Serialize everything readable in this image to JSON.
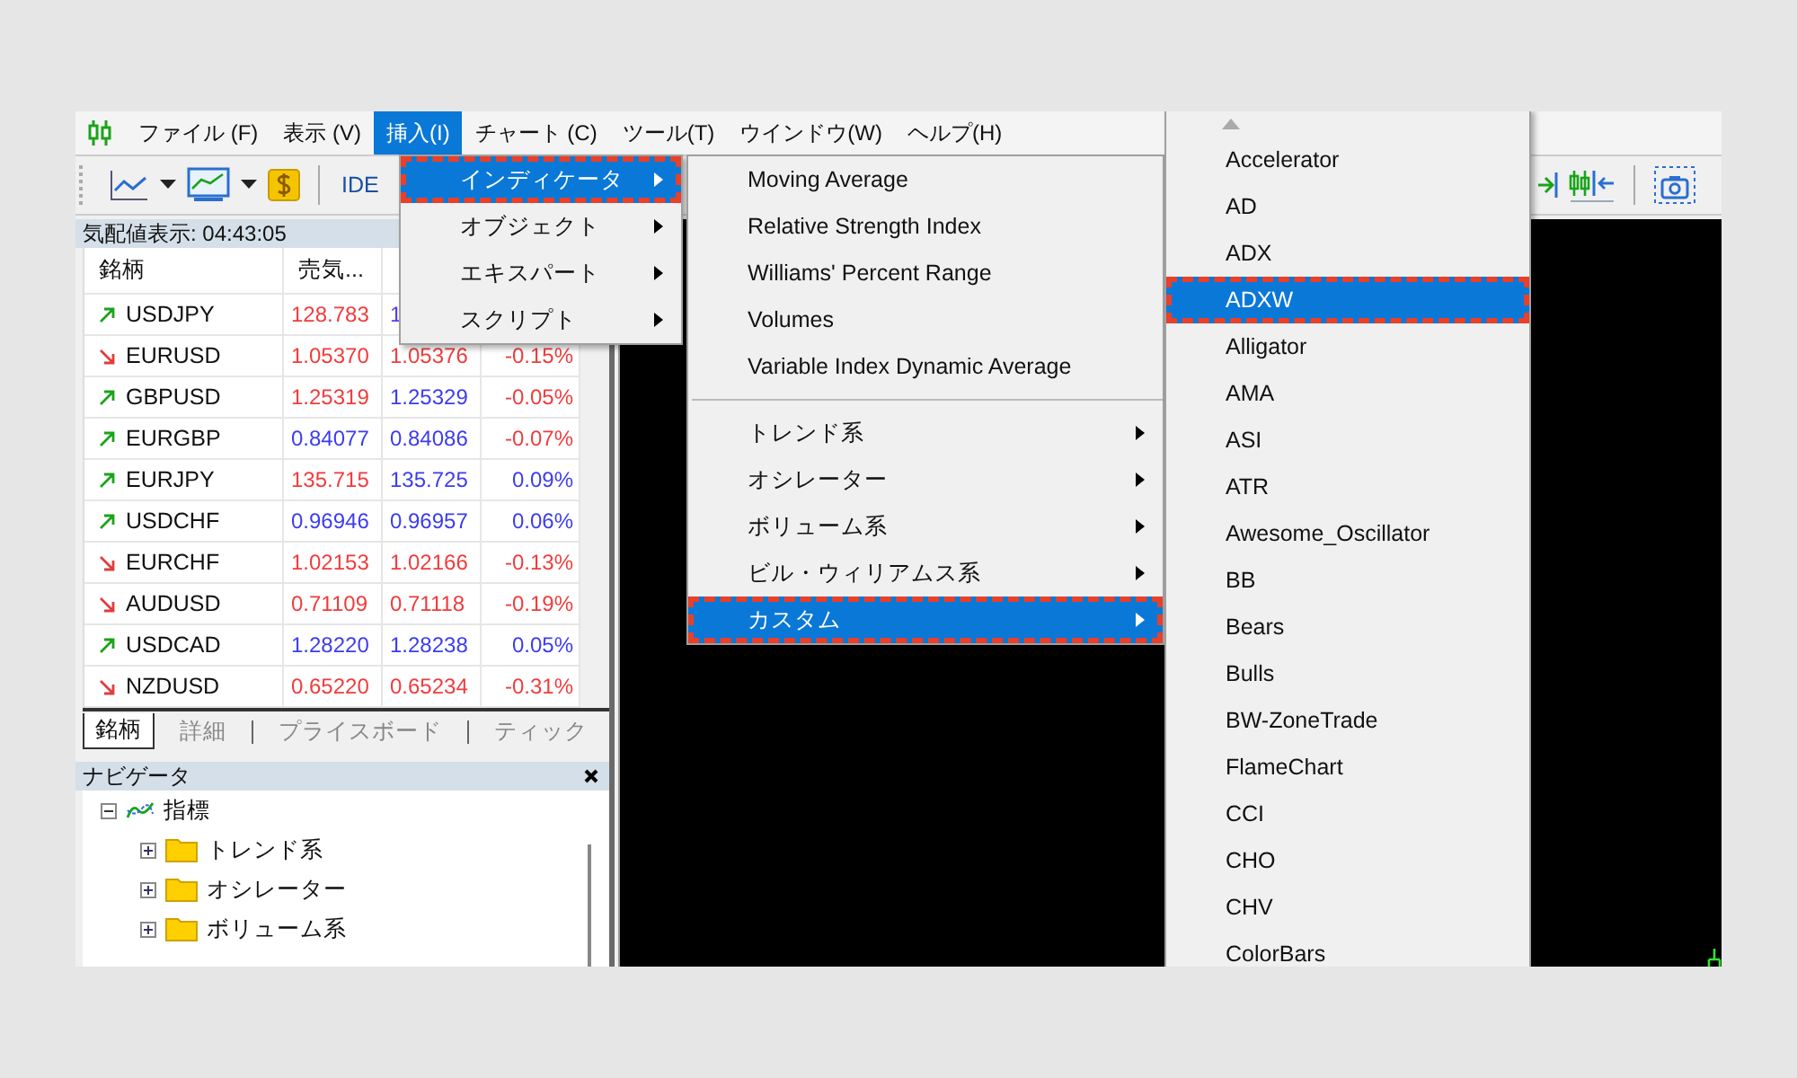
{
  "menu_bar": {
    "items": [
      {
        "label": "ファイル (F)",
        "selected": false
      },
      {
        "label": "表示 (V)",
        "selected": false
      },
      {
        "label": "挿入(I)",
        "selected": true
      },
      {
        "label": "チャート (C)",
        "selected": false
      },
      {
        "label": "ツール(T)",
        "selected": false
      },
      {
        "label": "ウインドウ(W)",
        "selected": false
      },
      {
        "label": "ヘルプ(H)",
        "selected": false
      }
    ]
  },
  "toolbar": {
    "ide_label": "IDE"
  },
  "market_watch": {
    "title": "気配値表示: 04:43:05",
    "columns": [
      "銘柄",
      "売気..."
    ],
    "rows": [
      {
        "symbol": "USDJPY",
        "rising": true,
        "bid": {
          "text": "128.783",
          "color": "#f03c3c"
        },
        "ask": {
          "text": "1",
          "color": "#5a3cf0"
        }
      },
      {
        "symbol": "EURUSD",
        "rising": false,
        "bid": {
          "text": "1.05370",
          "color": "#f03c3c"
        },
        "ask": {
          "text": "1.05376",
          "color": "#f03c3c"
        },
        "change": {
          "text": "-0.15%",
          "color": "#f03c3c"
        }
      },
      {
        "symbol": "GBPUSD",
        "rising": true,
        "bid": {
          "text": "1.25319",
          "color": "#f03c3c"
        },
        "ask": {
          "text": "1.25329",
          "color": "#3c3cf0"
        },
        "change": {
          "text": "-0.05%",
          "color": "#f03c3c"
        }
      },
      {
        "symbol": "EURGBP",
        "rising": true,
        "bid": {
          "text": "0.84077",
          "color": "#3c3cf0"
        },
        "ask": {
          "text": "0.84086",
          "color": "#3c3cf0"
        },
        "change": {
          "text": "-0.07%",
          "color": "#f03c3c"
        }
      },
      {
        "symbol": "EURJPY",
        "rising": true,
        "bid": {
          "text": "135.715",
          "color": "#f03c3c"
        },
        "ask": {
          "text": "135.725",
          "color": "#3c3cf0"
        },
        "change": {
          "text": "0.09%",
          "color": "#3c3cf0"
        }
      },
      {
        "symbol": "USDCHF",
        "rising": true,
        "bid": {
          "text": "0.96946",
          "color": "#3c3cf0"
        },
        "ask": {
          "text": "0.96957",
          "color": "#3c3cf0"
        },
        "change": {
          "text": "0.06%",
          "color": "#3c3cf0"
        }
      },
      {
        "symbol": "EURCHF",
        "rising": false,
        "bid": {
          "text": "1.02153",
          "color": "#f03c3c"
        },
        "ask": {
          "text": "1.02166",
          "color": "#f03c3c"
        },
        "change": {
          "text": "-0.13%",
          "color": "#f03c3c"
        }
      },
      {
        "symbol": "AUDUSD",
        "rising": false,
        "bid": {
          "text": "0.71109",
          "color": "#f03c3c"
        },
        "ask": {
          "text": "0.71118",
          "color": "#f03c3c"
        },
        "change": {
          "text": "-0.19%",
          "color": "#f03c3c"
        }
      },
      {
        "symbol": "USDCAD",
        "rising": true,
        "bid": {
          "text": "1.28220",
          "color": "#3c3cf0"
        },
        "ask": {
          "text": "1.28238",
          "color": "#3c3cf0"
        },
        "change": {
          "text": "0.05%",
          "color": "#3c3cf0"
        }
      },
      {
        "symbol": "NZDUSD",
        "rising": false,
        "bid": {
          "text": "0.65220",
          "color": "#f03c3c"
        },
        "ask": {
          "text": "0.65234",
          "color": "#f03c3c"
        },
        "change": {
          "text": "-0.31%",
          "color": "#f03c3c"
        }
      }
    ],
    "tabs": [
      {
        "label": "銘柄",
        "selected": true
      },
      {
        "label": "詳細",
        "selected": false
      },
      {
        "label": "プライスボード",
        "selected": false
      },
      {
        "label": "ティック",
        "selected": false
      }
    ]
  },
  "navigator": {
    "title": "ナビゲータ",
    "tree": [
      {
        "label": "指標",
        "expanded": true,
        "children": [
          {
            "label": "トレンド系",
            "expanded": false
          },
          {
            "label": "オシレーター",
            "expanded": false
          },
          {
            "label": "ボリューム系",
            "expanded": false
          }
        ]
      }
    ]
  },
  "insert_menu": {
    "items": [
      {
        "label": "インディケータ",
        "selected": true,
        "highlighted": true
      },
      {
        "label": "オブジェクト",
        "selected": false,
        "highlighted": false
      },
      {
        "label": "エキスパート",
        "selected": false,
        "highlighted": false
      },
      {
        "label": "スクリプト",
        "selected": false,
        "highlighted": false
      }
    ]
  },
  "indicator_menu": {
    "items": [
      {
        "kind": "item",
        "label": "Moving Average",
        "selected": false,
        "highlighted": false
      },
      {
        "kind": "item",
        "label": "Relative Strength Index",
        "selected": false,
        "highlighted": false
      },
      {
        "kind": "item",
        "label": "Williams' Percent Range",
        "selected": false,
        "highlighted": false
      },
      {
        "kind": "item",
        "label": "Volumes",
        "selected": false,
        "highlighted": false
      },
      {
        "kind": "item",
        "label": "Variable Index Dynamic Average",
        "selected": false,
        "highlighted": false
      },
      {
        "kind": "separator"
      },
      {
        "kind": "submenu",
        "label": "トレンド系",
        "selected": false,
        "highlighted": false
      },
      {
        "kind": "submenu",
        "label": "オシレーター",
        "selected": false,
        "highlighted": false
      },
      {
        "kind": "submenu",
        "label": "ボリューム系",
        "selected": false,
        "highlighted": false
      },
      {
        "kind": "submenu",
        "label": "ビル・ウィリアムス系",
        "selected": false,
        "highlighted": false
      },
      {
        "kind": "submenu",
        "label": "カスタム",
        "selected": true,
        "highlighted": true
      }
    ]
  },
  "custom_menu": {
    "items": [
      {
        "label": "Accelerator",
        "selected": false,
        "highlighted": false
      },
      {
        "label": "AD",
        "selected": false,
        "highlighted": false
      },
      {
        "label": "ADX",
        "selected": false,
        "highlighted": false
      },
      {
        "label": "ADXW",
        "selected": true,
        "highlighted": true
      },
      {
        "label": "Alligator",
        "selected": false,
        "highlighted": false
      },
      {
        "label": "AMA",
        "selected": false,
        "highlighted": false
      },
      {
        "label": "ASI",
        "selected": false,
        "highlighted": false
      },
      {
        "label": "ATR",
        "selected": false,
        "highlighted": false
      },
      {
        "label": "Awesome_Oscillator",
        "selected": false,
        "highlighted": false
      },
      {
        "label": "BB",
        "selected": false,
        "highlighted": false
      },
      {
        "label": "Bears",
        "selected": false,
        "highlighted": false
      },
      {
        "label": "Bulls",
        "selected": false,
        "highlighted": false
      },
      {
        "label": "BW-ZoneTrade",
        "selected": false,
        "highlighted": false
      },
      {
        "label": "FlameChart",
        "selected": false,
        "highlighted": false
      },
      {
        "label": "CCI",
        "selected": false,
        "highlighted": false
      },
      {
        "label": "CHO",
        "selected": false,
        "highlighted": false
      },
      {
        "label": "CHV",
        "selected": false,
        "highlighted": false
      },
      {
        "label": "ColorBars",
        "selected": false,
        "highlighted": false
      }
    ]
  }
}
